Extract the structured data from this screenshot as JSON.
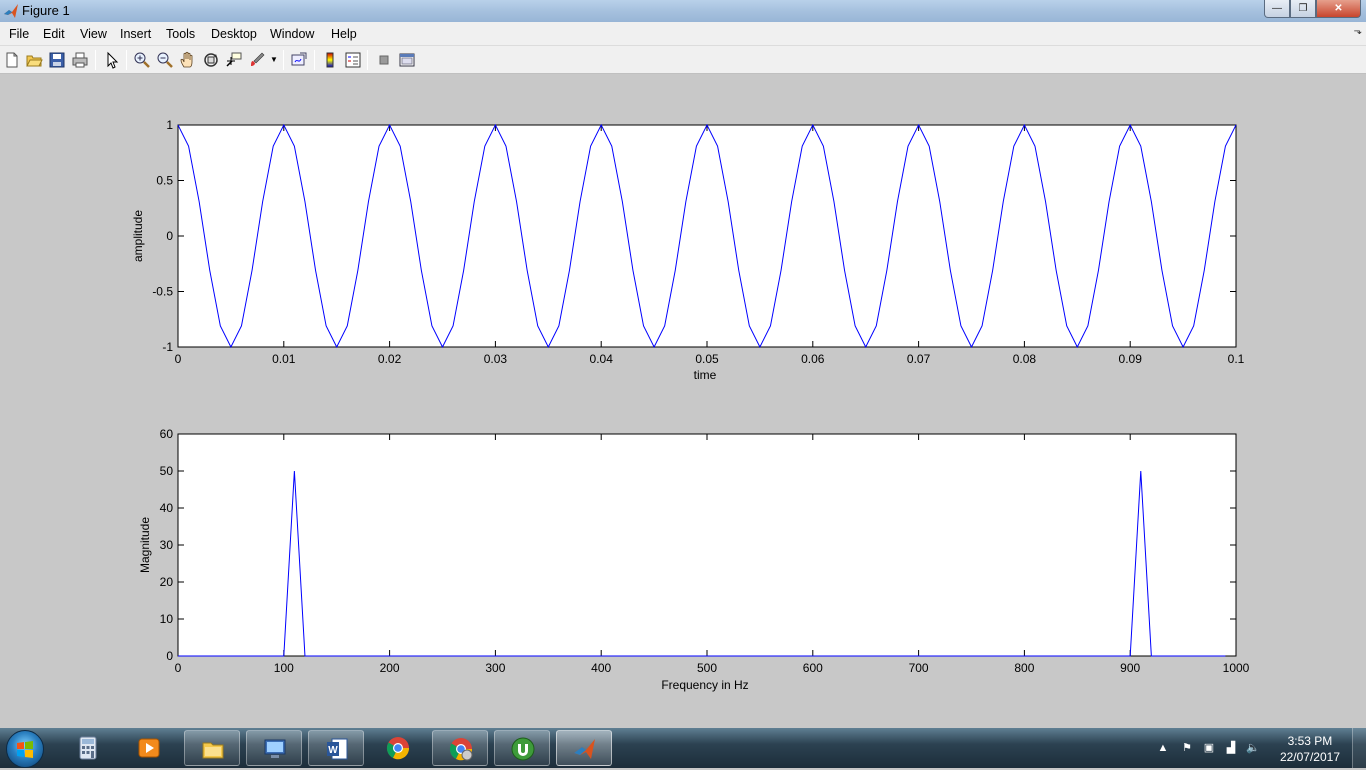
{
  "window": {
    "title": "Figure 1",
    "buttons": {
      "minimize": "—",
      "maximize": "❐",
      "close": "✕"
    }
  },
  "menu": {
    "items": [
      "File",
      "Edit",
      "View",
      "Insert",
      "Tools",
      "Desktop",
      "Window",
      "Help"
    ]
  },
  "toolbar": {
    "icons": [
      "new-figure-icon",
      "open-file-icon",
      "save-figure-icon",
      "print-figure-icon",
      "edit-plot-arrow-icon",
      "zoom-in-icon",
      "zoom-out-icon",
      "pan-hand-icon",
      "rotate-3d-icon",
      "data-cursor-icon",
      "brush-icon",
      "link-plot-icon",
      "insert-colorbar-icon",
      "insert-legend-icon",
      "hide-plot-tools-icon",
      "show-plot-tools-icon"
    ]
  },
  "chart_data": [
    {
      "type": "line",
      "title": "",
      "xlabel": "time",
      "ylabel": "amplitude",
      "xlim": [
        0,
        0.1
      ],
      "ylim": [
        -1,
        1
      ],
      "xticks": [
        "0",
        "0.01",
        "0.02",
        "0.03",
        "0.04",
        "0.05",
        "0.06",
        "0.07",
        "0.08",
        "0.09",
        "0.1"
      ],
      "yticks": [
        "-1",
        "-0.5",
        "0",
        "0.5",
        "1"
      ],
      "function": "cos(2*pi*100*t)",
      "frequency_hz": 100,
      "sample_rate_hz": 1000,
      "x_start": 0,
      "x_end": 0.1,
      "line_color": "#0000ff",
      "grid": false
    },
    {
      "type": "line",
      "title": "",
      "xlabel": "Frequency in Hz",
      "ylabel": "Magnitude",
      "xlim": [
        0,
        1000
      ],
      "ylim": [
        0,
        60
      ],
      "xticks": [
        "0",
        "100",
        "200",
        "300",
        "400",
        "500",
        "600",
        "700",
        "800",
        "900",
        "1000"
      ],
      "yticks": [
        "0",
        "10",
        "20",
        "30",
        "40",
        "50",
        "60"
      ],
      "x": [
        0,
        10,
        20,
        30,
        40,
        50,
        60,
        70,
        80,
        90,
        100,
        110,
        120,
        130,
        140,
        150,
        160,
        170,
        180,
        190,
        200,
        880,
        890,
        900,
        910,
        920,
        930,
        940,
        950,
        960,
        970,
        980,
        990
      ],
      "y": [
        0,
        0,
        0,
        0,
        0,
        0,
        0,
        0,
        0,
        0,
        0,
        50,
        0,
        0,
        0,
        0,
        0,
        0,
        0,
        0,
        0,
        0,
        0,
        0,
        50,
        0,
        0,
        0,
        0,
        0,
        0,
        0,
        0
      ],
      "line_color": "#0000ff",
      "grid": false
    }
  ],
  "taskbar": {
    "apps": [
      {
        "name": "calculator-icon",
        "state": "pinned"
      },
      {
        "name": "media-player-icon",
        "state": "pinned"
      },
      {
        "name": "file-explorer-icon",
        "state": "running"
      },
      {
        "name": "remote-desktop-icon",
        "state": "running"
      },
      {
        "name": "word-icon",
        "state": "running"
      },
      {
        "name": "chrome-icon",
        "state": "pinned"
      },
      {
        "name": "chrome-user-icon",
        "state": "running"
      },
      {
        "name": "utorrent-icon",
        "state": "running"
      },
      {
        "name": "matlab-icon",
        "state": "active"
      }
    ],
    "tray_icons": [
      "show-hidden-icons-arrow",
      "flag-icon",
      "network-device-icon",
      "signal-bars-icon",
      "volume-icon"
    ],
    "time": "3:53 PM",
    "date": "22/07/2017"
  }
}
